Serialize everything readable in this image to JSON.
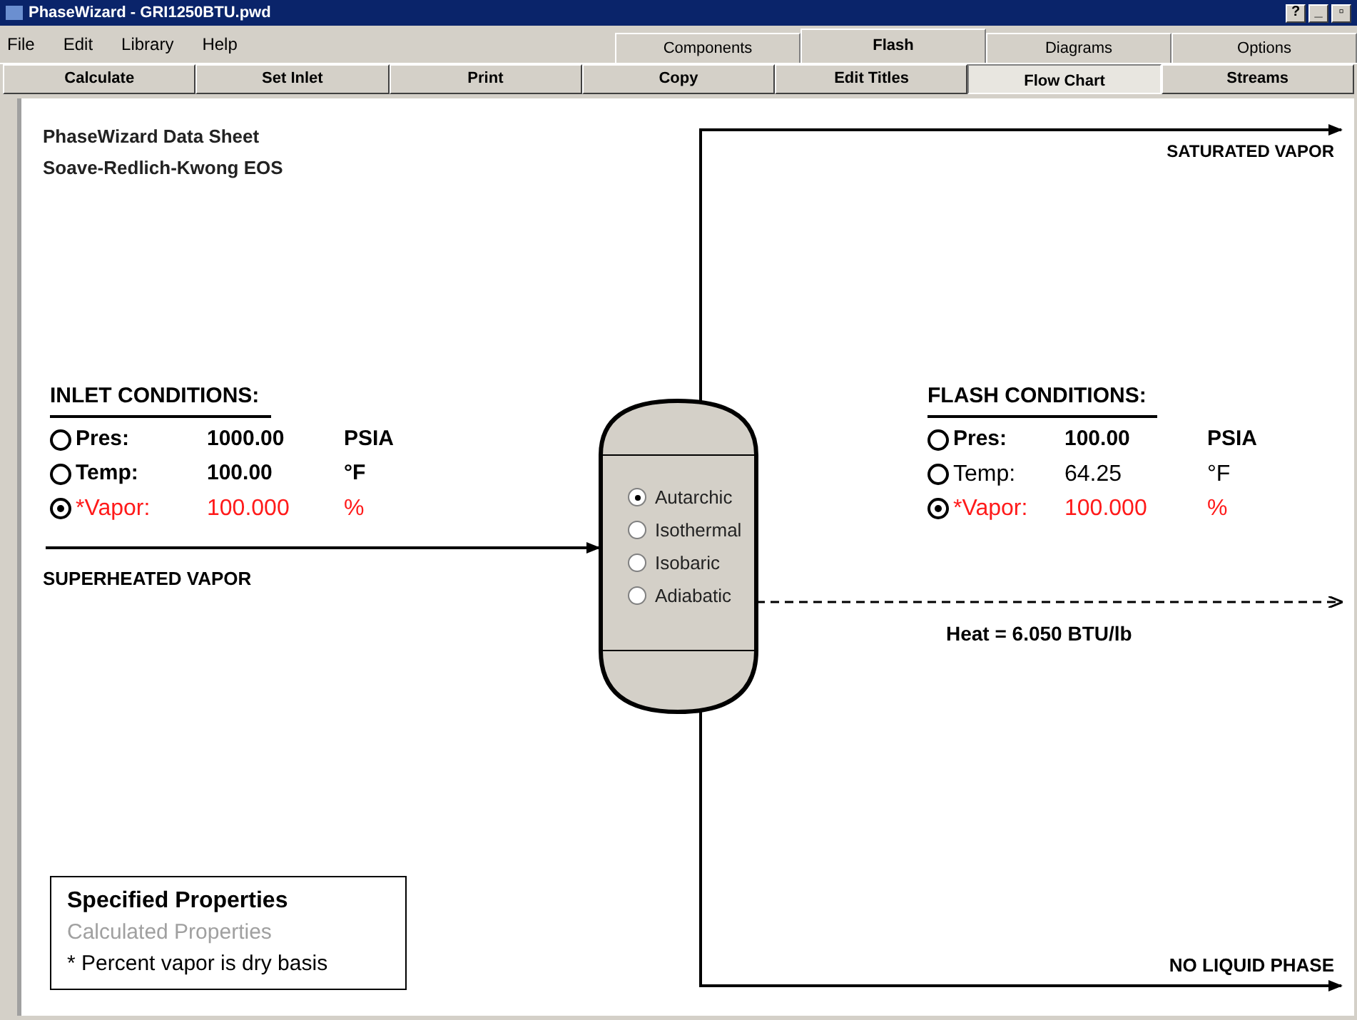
{
  "window": {
    "title": "PhaseWizard - GRI1250BTU.pwd",
    "controls": [
      "?",
      "_",
      "▫"
    ]
  },
  "menu": [
    "File",
    "Edit",
    "Library",
    "Help"
  ],
  "tabs": [
    {
      "label": "Components",
      "selected": false
    },
    {
      "label": "Flash",
      "selected": true
    },
    {
      "label": "Diagrams",
      "selected": false
    },
    {
      "label": "Options",
      "selected": false
    }
  ],
  "toolbar": [
    {
      "label": "Calculate",
      "selected": false
    },
    {
      "label": "Set Inlet",
      "selected": false
    },
    {
      "label": "Print",
      "selected": false
    },
    {
      "label": "Copy",
      "selected": false
    },
    {
      "label": "Edit Titles",
      "selected": false
    },
    {
      "label": "Flow Chart",
      "selected": true
    },
    {
      "label": "Streams",
      "selected": false
    }
  ],
  "sheet": {
    "title": "PhaseWizard Data Sheet",
    "subtitle": "Soave-Redlich-Kwong EOS"
  },
  "inlet": {
    "title": "INLET CONDITIONS:",
    "rows": [
      {
        "label": "Pres:",
        "value": "1000.00",
        "unit": "PSIA",
        "selected": false,
        "kind": "specified"
      },
      {
        "label": "Temp:",
        "value": "100.00",
        "unit": "°F",
        "selected": false,
        "kind": "specified"
      },
      {
        "label": "*Vapor:",
        "value": "100.000",
        "unit": "%",
        "selected": true,
        "kind": "vapor"
      }
    ]
  },
  "flash": {
    "title": "FLASH CONDITIONS:",
    "rows": [
      {
        "label": "Pres:",
        "value": "100.00",
        "unit": "PSIA",
        "selected": false,
        "kind": "specified"
      },
      {
        "label": "Temp:",
        "value": "64.25",
        "unit": "°F",
        "selected": false,
        "kind": "calculated"
      },
      {
        "label": "*Vapor:",
        "value": "100.000",
        "unit": "%",
        "selected": true,
        "kind": "vapor"
      }
    ]
  },
  "modes": [
    {
      "label": "Autarchic",
      "selected": true
    },
    {
      "label": "Isothermal",
      "selected": false
    },
    {
      "label": "Isobaric",
      "selected": false
    },
    {
      "label": "Adiabatic",
      "selected": false
    }
  ],
  "streams": {
    "inlet": "SUPERHEATED VAPOR",
    "vapor": "SATURATED VAPOR",
    "liquid": "NO LIQUID PHASE",
    "heat": "Heat = 6.050 BTU/lb"
  },
  "legend": [
    {
      "text": "Specified Properties",
      "kind": "specified"
    },
    {
      "text": "Calculated Properties",
      "kind": "calculated"
    },
    {
      "text": "* Percent vapor is dry basis",
      "kind": "note"
    }
  ]
}
